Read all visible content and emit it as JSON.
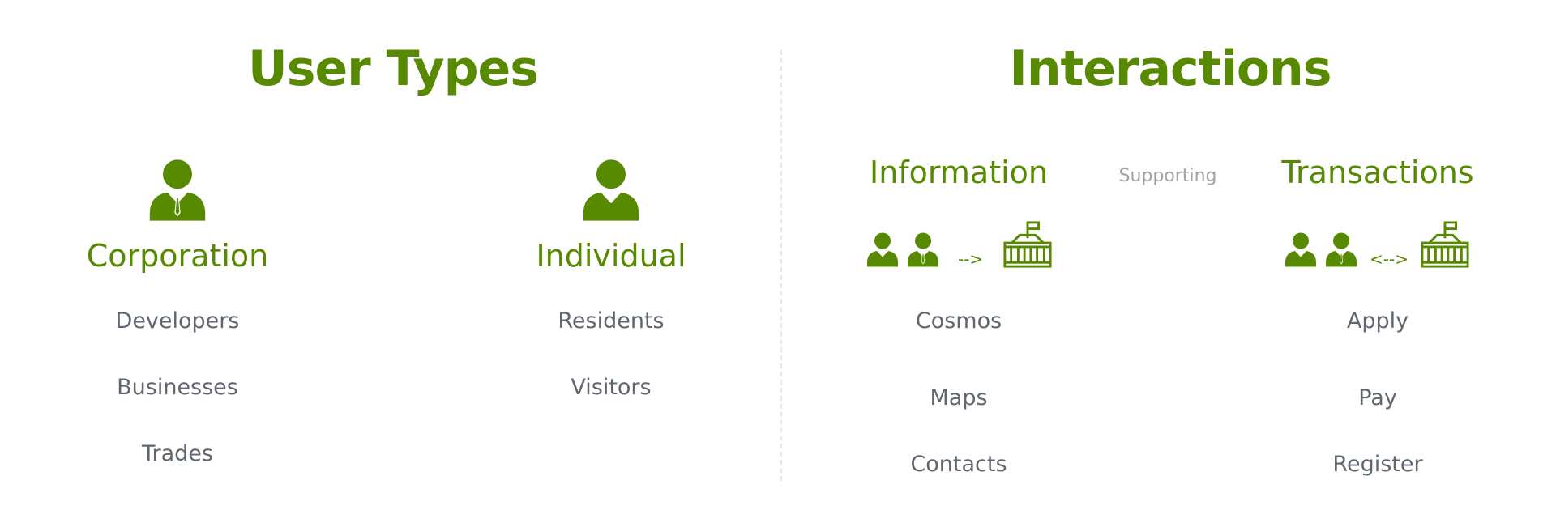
{
  "colors": {
    "accent": "#578a00",
    "item_text": "#5f6670",
    "muted": "#a3a3a3",
    "divider": "#e8e8e8"
  },
  "user_types": {
    "title": "User Types",
    "corporation": {
      "heading": "Corporation",
      "icon": "business-person-icon",
      "items": [
        "Developers",
        "Businesses",
        "Trades"
      ]
    },
    "individual": {
      "heading": "Individual",
      "icon": "person-icon",
      "items": [
        "Residents",
        "Visitors"
      ]
    }
  },
  "interactions": {
    "title": "Interactions",
    "supporting_label": "Supporting",
    "information": {
      "heading": "Information",
      "arrow": "-->",
      "icons": [
        "person-icon",
        "business-person-icon",
        "government-building-icon"
      ],
      "items": [
        "Cosmos",
        "Maps",
        "Contacts"
      ]
    },
    "transactions": {
      "heading": "Transactions",
      "arrow": "<-->",
      "icons": [
        "person-icon",
        "business-person-icon",
        "government-building-icon"
      ],
      "items": [
        "Apply",
        "Pay",
        "Register"
      ]
    }
  }
}
